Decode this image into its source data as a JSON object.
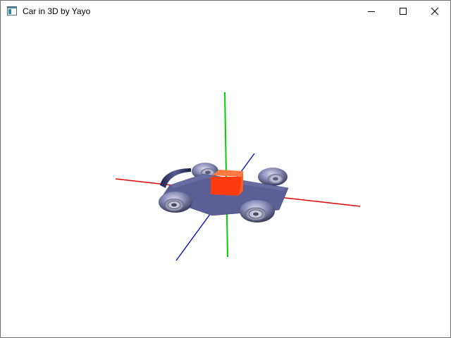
{
  "window": {
    "title": "Car in 3D by Yayo",
    "icon": "app-window-icon",
    "controls": {
      "minimize_icon": "minimize-icon",
      "maximize_icon": "maximize-icon",
      "close_icon": "close-icon"
    }
  },
  "scene": {
    "background": "#ffffff",
    "axes": {
      "x_color": "#e00000",
      "y_color": "#00d000",
      "z_color": "#0000c8"
    },
    "car": {
      "chassis_color": "#5c5f96",
      "cabin_color": "#ff3b10",
      "cabin_top_color": "#ff7a40",
      "wheel_color": "#8a8db8",
      "wheel_count": 4
    }
  }
}
